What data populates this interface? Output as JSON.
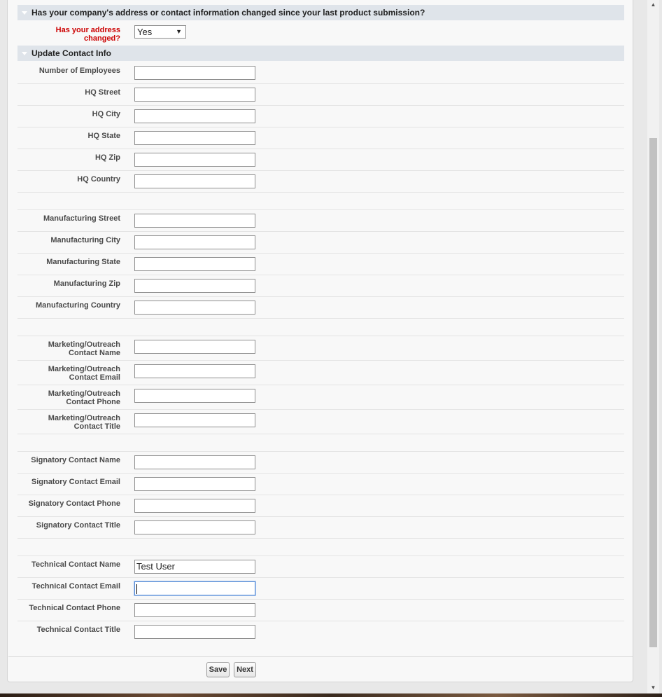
{
  "sections": {
    "address_changed_title": "Has your company's address or contact information changed since your last product submission?",
    "update_contact_title": "Update Contact Info"
  },
  "address_question": {
    "label_line1": "Has your address",
    "label_line2": "changed?",
    "selected": "Yes"
  },
  "fields": {
    "num_employees": {
      "label": "Number of Employees",
      "value": ""
    },
    "hq_street": {
      "label": "HQ Street",
      "value": ""
    },
    "hq_city": {
      "label": "HQ City",
      "value": ""
    },
    "hq_state": {
      "label": "HQ State",
      "value": ""
    },
    "hq_zip": {
      "label": "HQ Zip",
      "value": ""
    },
    "hq_country": {
      "label": "HQ Country",
      "value": ""
    },
    "mfg_street": {
      "label": "Manufacturing Street",
      "value": ""
    },
    "mfg_city": {
      "label": "Manufacturing City",
      "value": ""
    },
    "mfg_state": {
      "label": "Manufacturing State",
      "value": ""
    },
    "mfg_zip": {
      "label": "Manufacturing Zip",
      "value": ""
    },
    "mfg_country": {
      "label": "Manufacturing Country",
      "value": ""
    },
    "mkt_name": {
      "label1": "Marketing/Outreach",
      "label2": "Contact Name",
      "value": ""
    },
    "mkt_email": {
      "label1": "Marketing/Outreach",
      "label2": "Contact Email",
      "value": ""
    },
    "mkt_phone": {
      "label1": "Marketing/Outreach",
      "label2": "Contact Phone",
      "value": ""
    },
    "mkt_title": {
      "label1": "Marketing/Outreach",
      "label2": "Contact Title",
      "value": ""
    },
    "sig_name": {
      "label": "Signatory Contact Name",
      "value": ""
    },
    "sig_email": {
      "label": "Signatory Contact Email",
      "value": ""
    },
    "sig_phone": {
      "label": "Signatory Contact Phone",
      "value": ""
    },
    "sig_title": {
      "label": "Signatory Contact Title",
      "value": ""
    },
    "tech_name": {
      "label": "Technical Contact Name",
      "value": "Test User"
    },
    "tech_email": {
      "label": "Technical Contact Email",
      "value": ""
    },
    "tech_phone": {
      "label": "Technical Contact Phone",
      "value": ""
    },
    "tech_title": {
      "label": "Technical Contact Title",
      "value": ""
    }
  },
  "buttons": {
    "save": "Save",
    "next": "Next"
  },
  "icons": {
    "section_toggle": "triangle-down-icon",
    "select_arrow": "caret-down-icon"
  }
}
